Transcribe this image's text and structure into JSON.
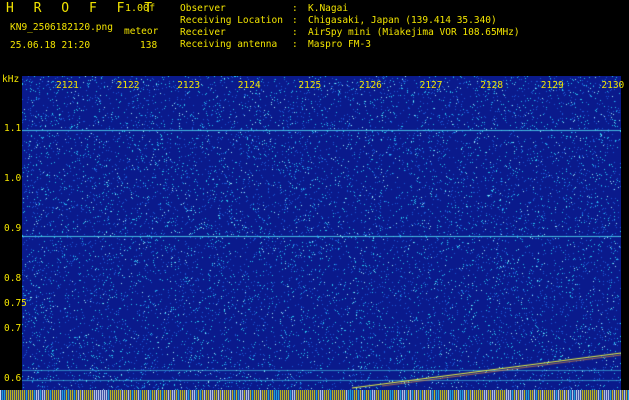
{
  "header": {
    "brand": "H R O F F T",
    "version": "1.00f",
    "filename": "KN9_2506182120.png",
    "mode": "meteor",
    "datetime": "25.06.18 21:20",
    "count": "138",
    "fields": [
      {
        "key": "Observer",
        "sep": ":",
        "value": "K.Nagai"
      },
      {
        "key": "Receiving Location",
        "sep": ":",
        "value": "Chigasaki, Japan (139.414 35.340)"
      },
      {
        "key": "Receiver",
        "sep": ":",
        "value": "AirSpy mini (Miakejima VOR 108.65MHz)"
      },
      {
        "key": "Receiving antenna",
        "sep": ":",
        "value": "Maspro FM-3"
      }
    ]
  },
  "axes": {
    "y_unit": "kHz",
    "y_ticks": [
      {
        "label": "1.1",
        "value": 1.1
      },
      {
        "label": "1.0",
        "value": 1.0
      },
      {
        "label": "0.9",
        "value": 0.9
      },
      {
        "label": "0.8",
        "value": 0.8
      },
      {
        "label": "0.75",
        "value": 0.75
      },
      {
        "label": "0.7",
        "value": 0.7
      },
      {
        "label": "0.6",
        "value": 0.6
      }
    ],
    "x_ticks": [
      "2121",
      "2122",
      "2123",
      "2124",
      "2125",
      "2126",
      "2127",
      "2128",
      "2129",
      "2130"
    ]
  },
  "colors": {
    "label": "#f2e400",
    "background": "#0a1a8c",
    "noise_hi": "#29c8f0",
    "noise_mid": "#1a5ad8",
    "line": "#4fd8f0",
    "meteor": "#e8f040",
    "strip": "#f2e400"
  }
}
